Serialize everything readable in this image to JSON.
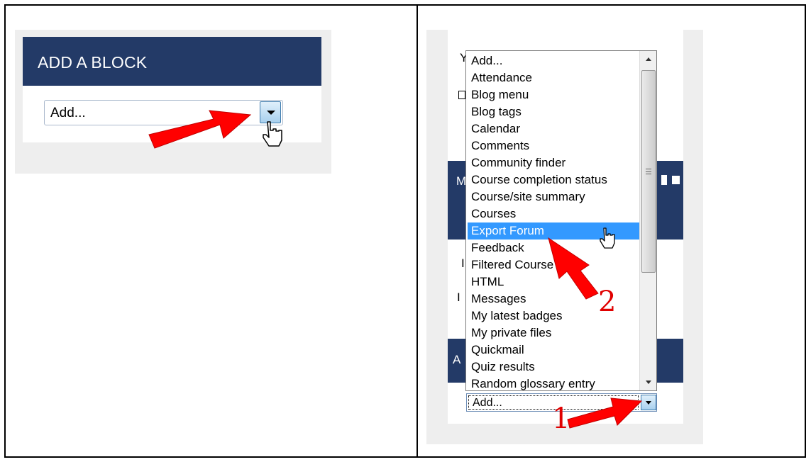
{
  "left_panel": {
    "title": "ADD A BLOCK",
    "select_value": "Add..."
  },
  "right_panel": {
    "fragments": [
      "Y",
      "M",
      "I",
      "I",
      "A"
    ],
    "dropdown_items": [
      "Add...",
      "Attendance",
      "Blog menu",
      "Blog tags",
      "Calendar",
      "Comments",
      "Community finder",
      "Course completion status",
      "Course/site summary",
      "Courses",
      "Export Forum",
      "Feedback",
      "Filtered Course list",
      "HTML",
      "Messages",
      "My latest badges",
      "My private files",
      "Quickmail",
      "Quiz results",
      "Random glossary entry"
    ],
    "selected_item": "Export Forum",
    "select_value": "Add..."
  },
  "annotations": {
    "step1": "1",
    "step2": "2",
    "arrow_color": "#ff0000"
  }
}
